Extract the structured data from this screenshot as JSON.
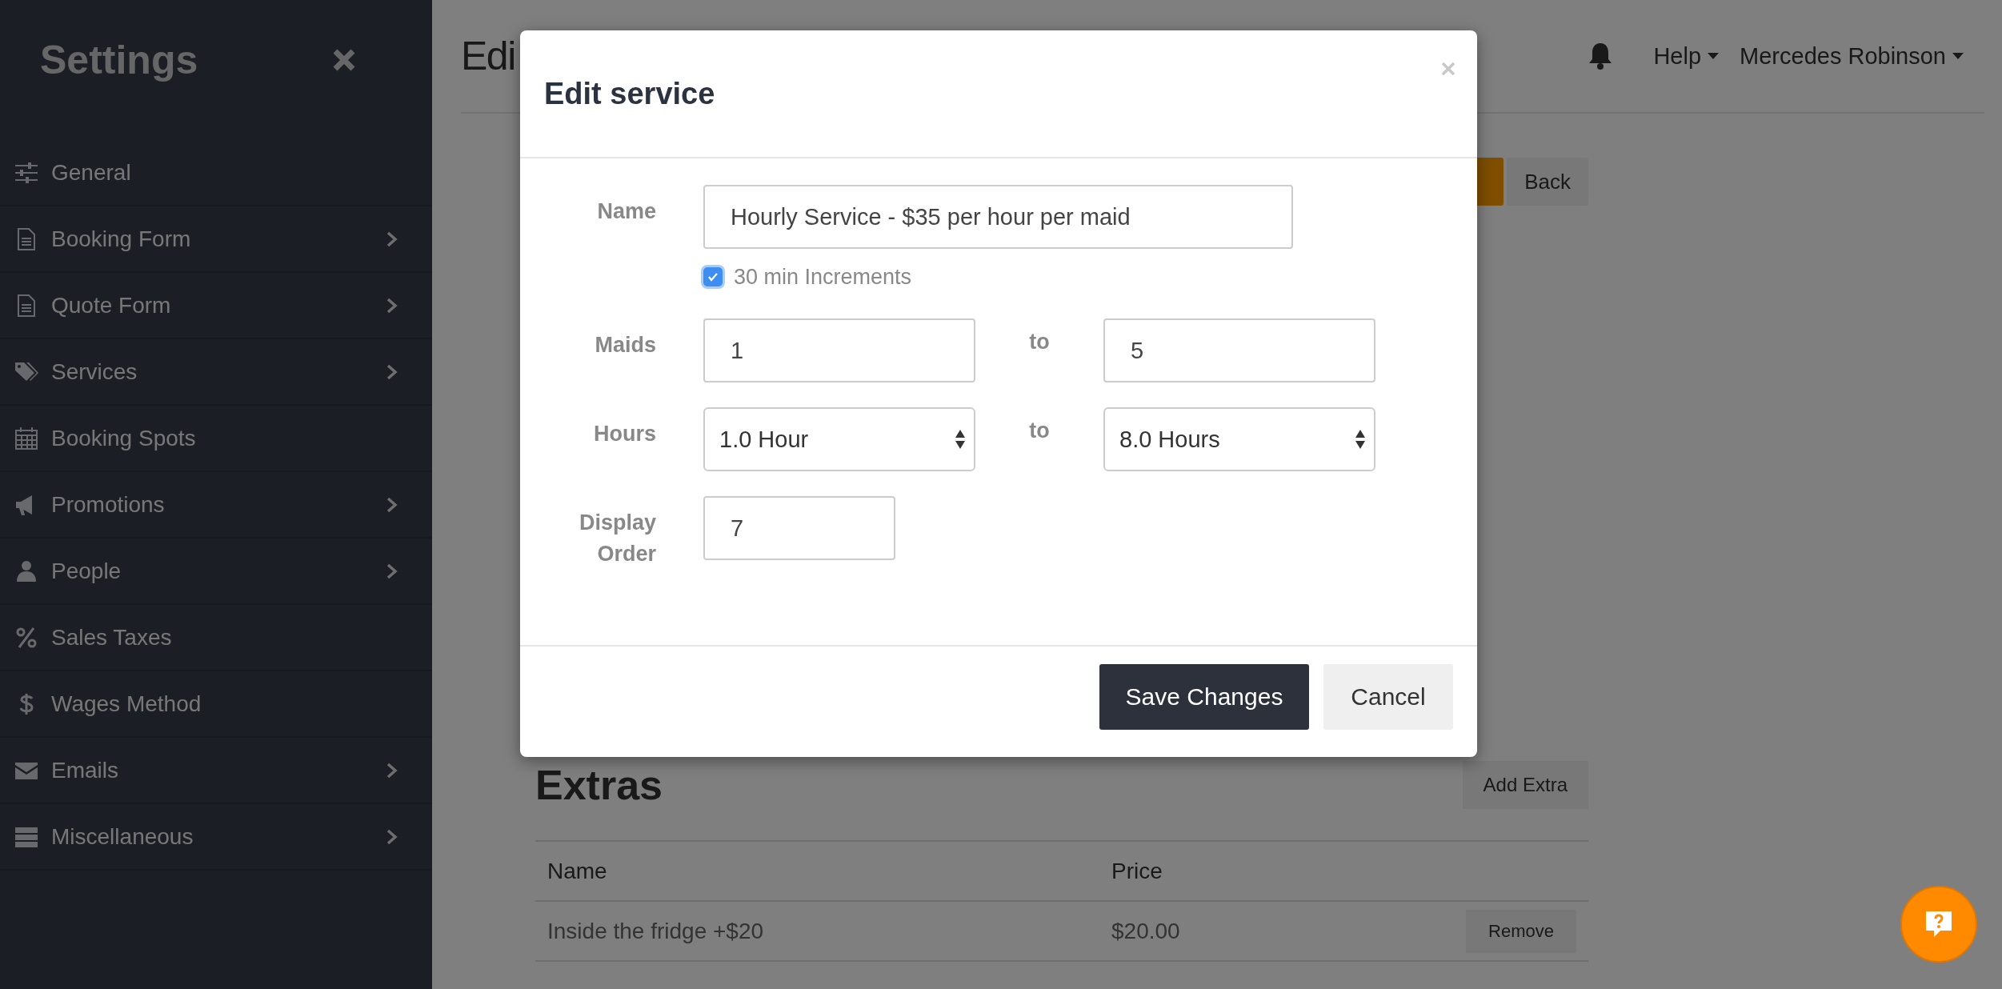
{
  "sidebar": {
    "title": "Settings",
    "items": [
      {
        "label": "General",
        "expandable": false
      },
      {
        "label": "Booking Form",
        "expandable": true
      },
      {
        "label": "Quote Form",
        "expandable": true
      },
      {
        "label": "Services",
        "expandable": true
      },
      {
        "label": "Booking Spots",
        "expandable": false
      },
      {
        "label": "Promotions",
        "expandable": true
      },
      {
        "label": "People",
        "expandable": true
      },
      {
        "label": "Sales Taxes",
        "expandable": false
      },
      {
        "label": "Wages Method",
        "expandable": false
      },
      {
        "label": "Emails",
        "expandable": true
      },
      {
        "label": "Miscellaneous",
        "expandable": true
      }
    ]
  },
  "header": {
    "title": "Edi",
    "menus": [
      "Help",
      "Mercedes Robinson"
    ]
  },
  "toolbar": [
    {
      "kind": "primary"
    },
    {
      "kind": "default",
      "label": "Back"
    }
  ],
  "extras": {
    "title": "Extras",
    "add_button": "Add Extra",
    "columns": [
      "Name",
      "Price"
    ],
    "rows": [
      {
        "name": "Inside the fridge +$20",
        "price": "$20.00",
        "action": "Remove"
      }
    ]
  },
  "modal": {
    "title": "Edit service",
    "name": {
      "label": "Name",
      "value": "Hourly Service - $35 per hour per maid"
    },
    "increments": {
      "label": "30 min Increments",
      "checked": true
    },
    "maids": {
      "label": "Maids",
      "from": "1",
      "separator": "to",
      "to": "5"
    },
    "hours": {
      "label": "Hours",
      "from": "1.0 Hour",
      "separator": "to",
      "to": "8.0 Hours"
    },
    "display_order": {
      "label": "Display Order",
      "value": "7"
    },
    "buttons": [
      {
        "kind": "primary",
        "label": "Save Changes"
      },
      {
        "kind": "default",
        "label": "Cancel"
      }
    ]
  }
}
